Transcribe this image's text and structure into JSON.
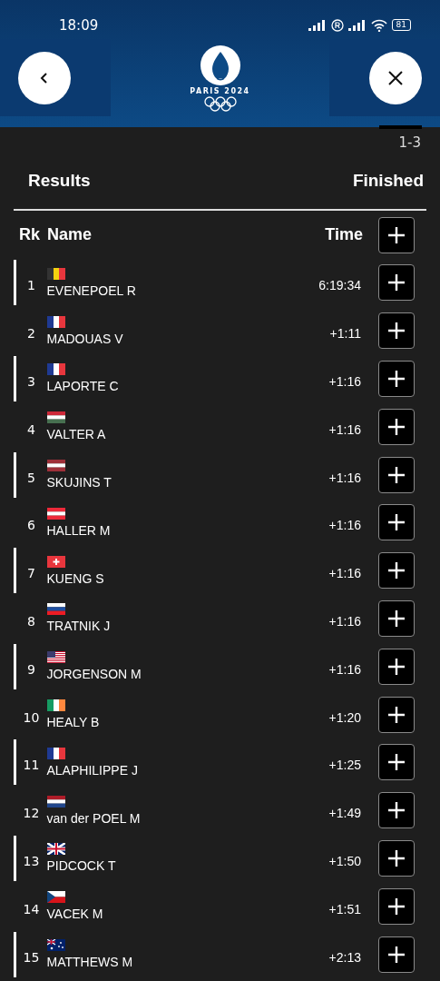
{
  "status_bar": {
    "time": "18:09",
    "battery": "81"
  },
  "header": {
    "logo_text": "PARIS 2024"
  },
  "pager": "1-3",
  "section": {
    "title": "Results",
    "status": "Finished"
  },
  "columns": {
    "rank": "Rk",
    "name": "Name",
    "time": "Time"
  },
  "rows": [
    {
      "rank": "1",
      "flag": {
        "kind": "belgian"
      },
      "name": "EVENEPOEL R",
      "time": "6:19:34",
      "highlighted": true
    },
    {
      "rank": "2",
      "flag": {
        "kind": "french"
      },
      "name": "MADOUAS V",
      "time": "+1:11",
      "highlighted": false
    },
    {
      "rank": "3",
      "flag": {
        "kind": "french"
      },
      "name": "LAPORTE C",
      "time": "+1:16",
      "highlighted": true
    },
    {
      "rank": "4",
      "flag": {
        "kind": "hungarian"
      },
      "name": "VALTER A",
      "time": "+1:16",
      "highlighted": false
    },
    {
      "rank": "5",
      "flag": {
        "kind": "latvian"
      },
      "name": "SKUJINS T",
      "time": "+1:16",
      "highlighted": true
    },
    {
      "rank": "6",
      "flag": {
        "kind": "austrian"
      },
      "name": "HALLER M",
      "time": "+1:16",
      "highlighted": false
    },
    {
      "rank": "7",
      "flag": {
        "kind": "swiss"
      },
      "name": "KUENG S",
      "time": "+1:16",
      "highlighted": true
    },
    {
      "rank": "8",
      "flag": {
        "kind": "slovenian"
      },
      "name": "TRATNIK J",
      "time": "+1:16",
      "highlighted": false
    },
    {
      "rank": "9",
      "flag": {
        "kind": "american"
      },
      "name": "JORGENSON M",
      "time": "+1:16",
      "highlighted": true
    },
    {
      "rank": "10",
      "flag": {
        "kind": "irish"
      },
      "name": "HEALY B",
      "time": "+1:20",
      "highlighted": false
    },
    {
      "rank": "11",
      "flag": {
        "kind": "french"
      },
      "name": "ALAPHILIPPE J",
      "time": "+1:25",
      "highlighted": true
    },
    {
      "rank": "12",
      "flag": {
        "kind": "dutch"
      },
      "name": "van der POEL M",
      "time": "+1:49",
      "highlighted": false
    },
    {
      "rank": "13",
      "flag": {
        "kind": "british"
      },
      "name": "PIDCOCK T",
      "time": "+1:50",
      "highlighted": true
    },
    {
      "rank": "14",
      "flag": {
        "kind": "czech"
      },
      "name": "VACEK M",
      "time": "+1:51",
      "highlighted": false
    },
    {
      "rank": "15",
      "flag": {
        "kind": "australian"
      },
      "name": "MATTHEWS M",
      "time": "+2:13",
      "highlighted": true
    }
  ]
}
